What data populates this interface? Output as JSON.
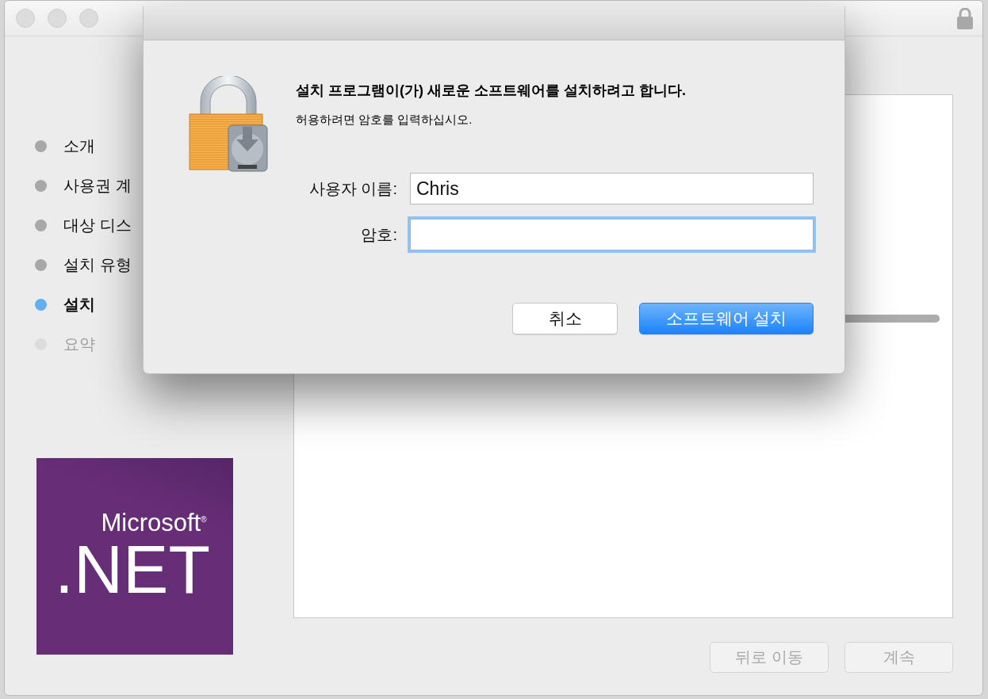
{
  "steps": [
    {
      "label": "소개",
      "kind": "done"
    },
    {
      "label": "사용권 계",
      "kind": "done"
    },
    {
      "label": "대상 디스",
      "kind": "done"
    },
    {
      "label": "설치 유형",
      "kind": "done"
    },
    {
      "label": "설치",
      "kind": "current"
    },
    {
      "label": "요약",
      "kind": "pending"
    }
  ],
  "logo": {
    "brand": "Microsoft$^{®}$",
    "product": ".NET"
  },
  "progress": {
    "level": 1
  },
  "buttons": [
    {
      "label": "뒤로 이동",
      "disabled": true
    },
    {
      "label": "계속",
      "disabled": true
    }
  ],
  "dialog": {
    "title": "설치 프로그램이(가) 새로운 소프트웨어를 설치하려고 합니다.",
    "message": "허용하려면 암호를 입력하십시오.",
    "fields": [
      {
        "label": "사용자 이름:",
        "value": "Chris",
        "focused": false
      },
      {
        "label": "암호:",
        "focused": true
      }
    ],
    "buttons": [
      {
        "label": "취소",
        "default": false
      },
      {
        "label": "소프트웨어 설치",
        "default": true
      }
    ]
  }
}
